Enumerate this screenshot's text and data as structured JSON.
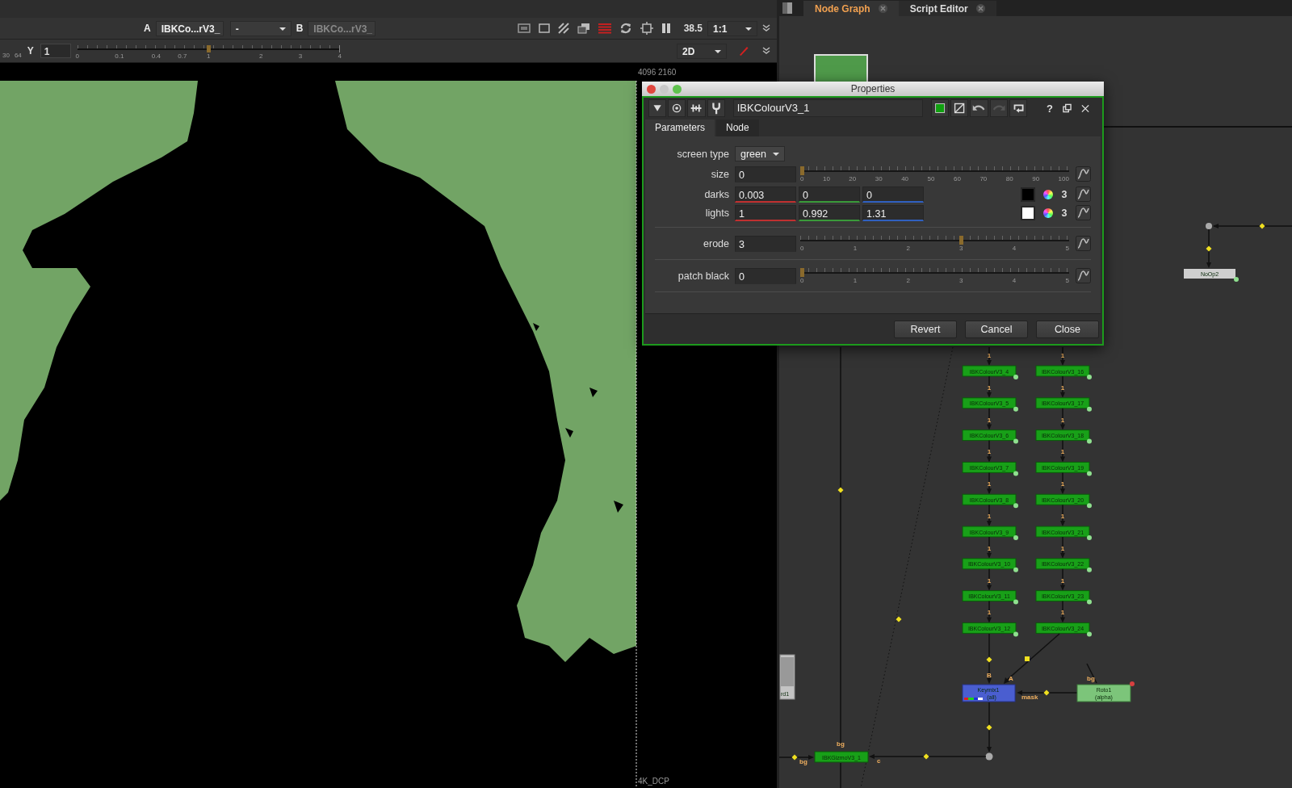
{
  "viewer": {
    "toolbar": {
      "input_a": {
        "label": "A",
        "value": "IBKCo...rV3_"
      },
      "operation": {
        "value": "-"
      },
      "input_b": {
        "label": "B",
        "value": "IBKCo...rV3_",
        "disabled": true
      },
      "zoom": "38.5",
      "scale": "1:1"
    },
    "gain_row": {
      "ruler_partial": [
        "30",
        "64"
      ],
      "channel_label": "Y",
      "gamma_value": "1",
      "slider": {
        "level": 0.5,
        "ticks": [
          "0",
          "0.1",
          "0.4",
          "0.7",
          "1",
          "2",
          "3",
          "4"
        ]
      },
      "view_mode": "2D"
    },
    "format_top": "4096 2160",
    "format_bottom": "4K_DCP"
  },
  "node_graph": {
    "tabs": [
      {
        "label": "Node Graph",
        "selected": true
      },
      {
        "label": "Script Editor",
        "selected": false
      }
    ],
    "noop": {
      "name": "NoOp2"
    },
    "checker": {
      "name": "rd1"
    },
    "columns": [
      {
        "nodes": [
          {
            "name": "IBKColourV3_4",
            "input_label": "1"
          },
          {
            "name": "IBKColourV3_5",
            "input_label": "1"
          },
          {
            "name": "IBKColourV3_6",
            "input_label": "1"
          },
          {
            "name": "IBKColourV3_7",
            "input_label": "1"
          },
          {
            "name": "IBKColourV3_8",
            "input_label": "1"
          },
          {
            "name": "IBKColourV3_9",
            "input_label": "1"
          },
          {
            "name": "IBKColourV3_10",
            "input_label": "1"
          },
          {
            "name": "IBKColourV3_11",
            "input_label": "1"
          },
          {
            "name": "IBKColourV3_12",
            "input_label": "1"
          }
        ]
      },
      {
        "nodes": [
          {
            "name": "IBKColourV3_16",
            "input_label": "1"
          },
          {
            "name": "IBKColourV3_17",
            "input_label": "1"
          },
          {
            "name": "IBKColourV3_18",
            "input_label": "1"
          },
          {
            "name": "IBKColourV3_19",
            "input_label": "1"
          },
          {
            "name": "IBKColourV3_20",
            "input_label": "1"
          },
          {
            "name": "IBKColourV3_21",
            "input_label": "1"
          },
          {
            "name": "IBKColourV3_22",
            "input_label": "1"
          },
          {
            "name": "IBKColourV3_23",
            "input_label": "1"
          },
          {
            "name": "IBKColourV3_24",
            "input_label": "1"
          }
        ]
      }
    ],
    "keymix": {
      "name": "Keymix1",
      "subtitle": "(all)",
      "input_b": "B",
      "input_a": "A",
      "mask_label": "mask"
    },
    "roto": {
      "name": "Roto1",
      "subtitle": "(alpha)",
      "input_label": "bg"
    },
    "gizmo": {
      "name": "IBKGizmoV3_1",
      "bg_top": "bg",
      "bg_left": "bg",
      "c_label": "c"
    }
  },
  "properties": {
    "title": "Properties",
    "node_name": "IBKColourV3_1",
    "help": "?",
    "tabs": [
      {
        "label": "Parameters",
        "selected": true
      },
      {
        "label": "Node",
        "selected": false
      }
    ],
    "screen_type": {
      "label": "screen type",
      "value": "green"
    },
    "knobs": [
      {
        "kind": "slider",
        "label": "size",
        "value": "0",
        "level": 0,
        "ticks": [
          "0",
          "10",
          "20",
          "30",
          "40",
          "50",
          "60",
          "70",
          "80",
          "90",
          "100"
        ]
      },
      {
        "kind": "rgb",
        "label": "darks",
        "values": [
          "0.003",
          "0",
          "0"
        ],
        "color": "#000000",
        "channels": "3"
      },
      {
        "kind": "rgb",
        "label": "lights",
        "values": [
          "1",
          "0.992",
          "1.31"
        ],
        "color": "#ffffff",
        "channels": "3"
      },
      {
        "kind": "slider",
        "label": "erode",
        "value": "3",
        "level": 0.6,
        "ticks": [
          "0",
          "1",
          "2",
          "3",
          "4",
          "5"
        ],
        "divider": true
      },
      {
        "kind": "slider",
        "label": "patch black",
        "value": "0",
        "level": 0,
        "ticks": [
          "0",
          "1",
          "2",
          "3",
          "4",
          "5"
        ],
        "divider": true
      }
    ],
    "buttons": [
      "Revert",
      "Cancel",
      "Close"
    ]
  }
}
